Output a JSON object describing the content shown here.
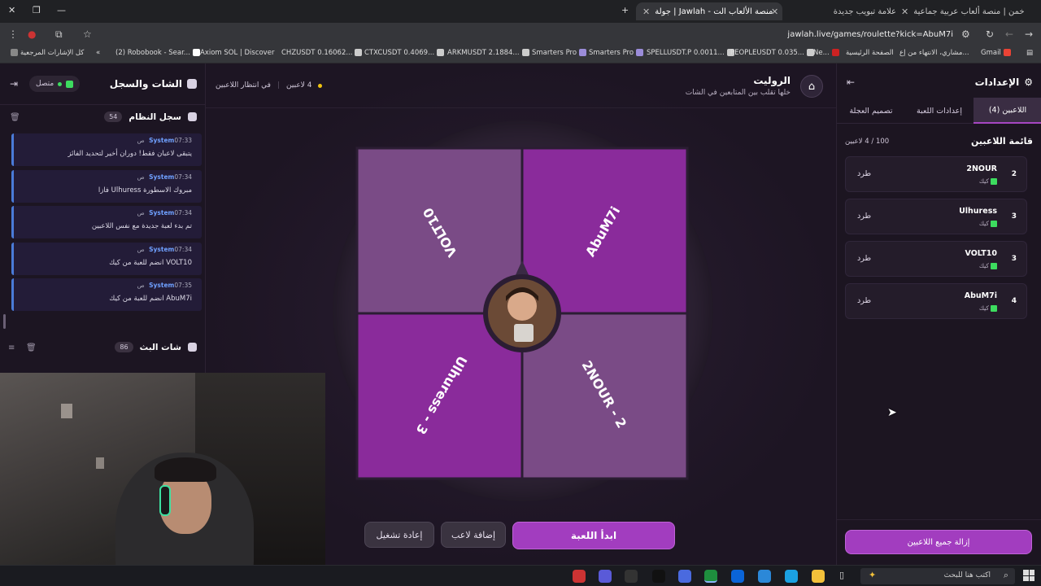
{
  "browser": {
    "tabs": [
      {
        "title": "خمن | منصة ألعاب عربية جماعية",
        "active": false
      },
      {
        "title": "علامة تبويب جديدة",
        "active": false
      },
      {
        "title": "جولة | Jawlah - منصة الألعاب الت",
        "active": true
      }
    ],
    "url": "jawlah.live/games/roulette?kick=AbuM7i",
    "bookmarks": [
      "Gmail",
      "مشاري، الانتهاء من إع...",
      "الصفحة الرئيسية",
      "Ne...",
      "PEOPLEUSDT 0.035...",
      "SPELLUSDT.P 0.0011...",
      "Smarters Pro",
      "Smarters Pro",
      "ARKMUSDT 2.1884...",
      "CTXCUSDT 0.4069...",
      "CHZUSDT 0.16062...",
      "Axiom SOL | Discover",
      "(2) Robobook - Sear...",
      "كل الإشارات المرجعية"
    ]
  },
  "left_panel": {
    "title": "الشات والسجل",
    "status": "متصل",
    "system_log": {
      "title": "سجل النظام",
      "count": "54",
      "messages": [
        {
          "sender": "System",
          "time": "07:33 ص",
          "text": "يتبقى لاعبان فقط! دوران أخير لتحديد الفائز"
        },
        {
          "sender": "System",
          "time": "07:34 ص",
          "text": "مبروك الاسطورة Ulhuress فازا"
        },
        {
          "sender": "System",
          "time": "07:34 ص",
          "text": "تم بدء لعبة جديدة مع نفس اللاعبين"
        },
        {
          "sender": "System",
          "time": "07:34 ص",
          "text": "VOLT10 انضم للعبة من كيك"
        },
        {
          "sender": "System",
          "time": "07:35 ص",
          "text": "AbuM7i انضم للعبة من كيك"
        }
      ]
    },
    "stream_chat": {
      "title": "شات البث",
      "count": "86"
    }
  },
  "center": {
    "title": "الروليت",
    "subtitle": "خلها تقلب بين المتابعين في الشات",
    "players_count": "4 لاعبين",
    "status": "في انتظار اللاعبين",
    "wheel": {
      "segments": [
        {
          "label": "AbuM7i",
          "color": "#8a2b9b"
        },
        {
          "label": "2NOUR - 2",
          "color": "#7a4b86"
        },
        {
          "label": "Ulhuress - 3",
          "color": "#8a2b9b"
        },
        {
          "label": "VOLT10",
          "color": "#7a4b86"
        }
      ]
    },
    "buttons": {
      "start": "ابدأ اللعبة",
      "add_player": "إضافة لاعب",
      "restart": "إعادة تشغيل"
    }
  },
  "right_panel": {
    "title": "الإعدادات",
    "tabs": [
      "اللاعبين (4)",
      "إعدادات اللعبة",
      "تصميم العجلة"
    ],
    "list_title": "قائمة اللاعبين",
    "list_count": "100 / 4 لاعبين",
    "players": [
      {
        "rank": "2",
        "name": "2NOUR",
        "platform": "كيك",
        "action": "طرد"
      },
      {
        "rank": "3",
        "name": "Ulhuress",
        "platform": "كيك",
        "action": "طرد"
      },
      {
        "rank": "3",
        "name": "VOLT10",
        "platform": "كيك",
        "action": "طرد"
      },
      {
        "rank": "4",
        "name": "AbuM7i",
        "platform": "كيك",
        "action": "طرد"
      }
    ],
    "remove_all": "إزالة جميع اللاعبين"
  },
  "taskbar": {
    "search_placeholder": "اكتب هنا للبحث"
  },
  "colors": {
    "accent": "#a23dbf",
    "wheel_dark": "#8a2b9b",
    "wheel_light": "#7a4b86",
    "online": "#3ddc5f"
  }
}
